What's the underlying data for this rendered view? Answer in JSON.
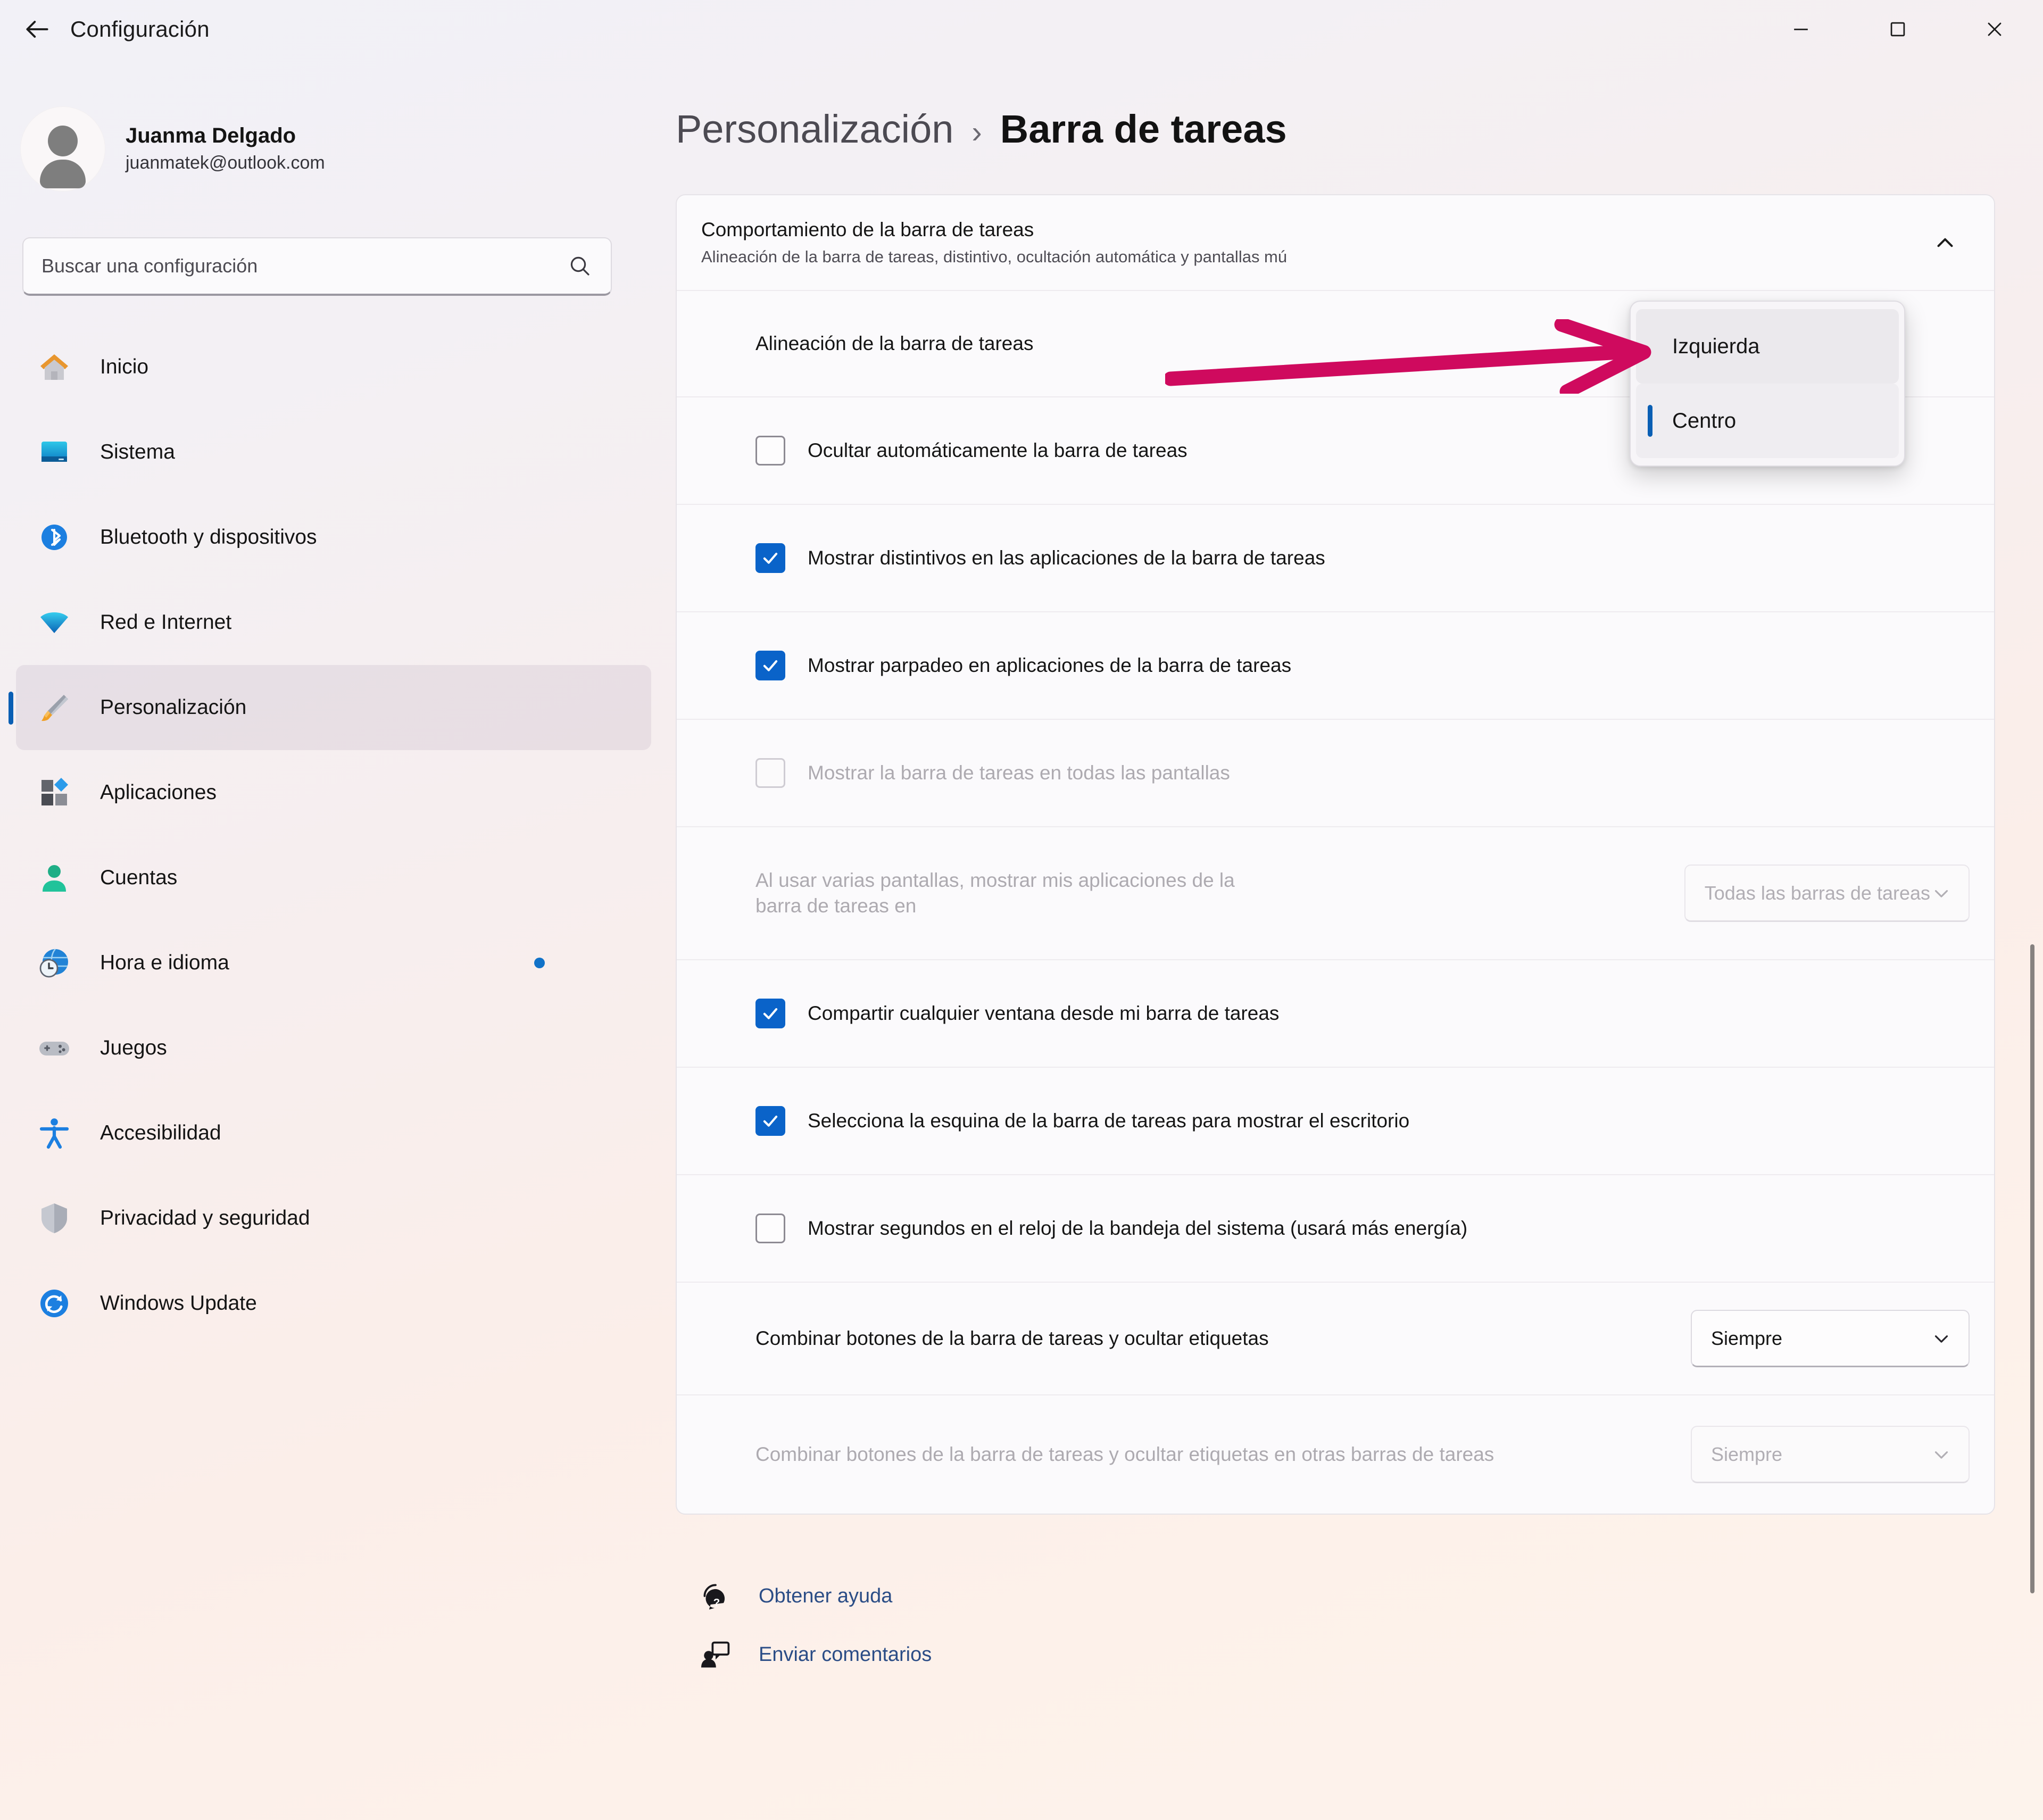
{
  "window": {
    "app_title": "Configuración",
    "back_label": "back-arrow",
    "controls": {
      "minimize": "—",
      "maximize": "▢",
      "close": "✕"
    }
  },
  "sidebar": {
    "account": {
      "name": "Juanma Delgado",
      "email": "juanmatek@outlook.com"
    },
    "search": {
      "placeholder": "Buscar una configuración"
    },
    "items": [
      {
        "label": "Inicio",
        "icon": "home-icon",
        "selected": false,
        "dot": false
      },
      {
        "label": "Sistema",
        "icon": "system-icon",
        "selected": false,
        "dot": false
      },
      {
        "label": "Bluetooth y dispositivos",
        "icon": "bluetooth-icon",
        "selected": false,
        "dot": false
      },
      {
        "label": "Red e Internet",
        "icon": "wifi-icon",
        "selected": false,
        "dot": false
      },
      {
        "label": "Personalización",
        "icon": "brush-icon",
        "selected": true,
        "dot": false
      },
      {
        "label": "Aplicaciones",
        "icon": "apps-icon",
        "selected": false,
        "dot": false
      },
      {
        "label": "Cuentas",
        "icon": "account-icon",
        "selected": false,
        "dot": false
      },
      {
        "label": "Hora e idioma",
        "icon": "clock-globe-icon",
        "selected": false,
        "dot": true
      },
      {
        "label": "Juegos",
        "icon": "gamepad-icon",
        "selected": false,
        "dot": false
      },
      {
        "label": "Accesibilidad",
        "icon": "accessibility-icon",
        "selected": false,
        "dot": false
      },
      {
        "label": "Privacidad y seguridad",
        "icon": "shield-icon",
        "selected": false,
        "dot": false
      },
      {
        "label": "Windows Update",
        "icon": "update-icon",
        "selected": false,
        "dot": false
      }
    ]
  },
  "main": {
    "breadcrumb": {
      "parent": "Personalización",
      "separator": "›",
      "current": "Barra de tareas"
    },
    "section": {
      "title": "Comportamiento de la barra de tareas",
      "subtitle": "Alineación de la barra de tareas, distintivo, ocultación automática y pantallas mú",
      "expanded": true,
      "chevron": "chevron-up-icon"
    },
    "rows": [
      {
        "kind": "combo",
        "label": "Alineación de la barra de tareas",
        "value": "",
        "disabled": false
      },
      {
        "kind": "checkbox",
        "label": "Ocultar automáticamente la barra de tareas",
        "checked": false,
        "disabled": false
      },
      {
        "kind": "checkbox",
        "label": "Mostrar distintivos en las aplicaciones de la barra de tareas",
        "checked": true,
        "disabled": false
      },
      {
        "kind": "checkbox",
        "label": "Mostrar parpadeo en aplicaciones de la barra de tareas",
        "checked": true,
        "disabled": false
      },
      {
        "kind": "checkbox",
        "label": "Mostrar la barra de tareas en todas las pantallas",
        "checked": false,
        "disabled": true
      },
      {
        "kind": "combo",
        "label": "Al usar varias pantallas, mostrar mis aplicaciones de la barra de tareas en",
        "value": "Todas las barras de tareas",
        "disabled": true
      },
      {
        "kind": "checkbox",
        "label": "Compartir cualquier ventana desde mi barra de tareas",
        "checked": true,
        "disabled": false
      },
      {
        "kind": "checkbox",
        "label": "Selecciona la esquina de la barra de tareas para mostrar el escritorio",
        "checked": true,
        "disabled": false
      },
      {
        "kind": "checkbox",
        "label": "Mostrar segundos en el reloj de la bandeja del sistema (usará más energía)",
        "checked": false,
        "disabled": false
      },
      {
        "kind": "combo",
        "label": "Combinar botones de la barra de tareas y ocultar etiquetas",
        "value": "Siempre",
        "disabled": false
      },
      {
        "kind": "combo",
        "label": "Combinar botones de la barra de tareas y ocultar etiquetas en otras barras de tareas",
        "value": "Siempre",
        "disabled": true
      }
    ],
    "footer_links": [
      {
        "label": "Obtener ayuda",
        "icon": "help-icon"
      },
      {
        "label": "Enviar comentarios",
        "icon": "feedback-icon"
      }
    ]
  },
  "flyout": {
    "options": [
      {
        "label": "Izquierda",
        "state": "hover"
      },
      {
        "label": "Centro",
        "state": "selected"
      }
    ]
  },
  "annotation": {
    "type": "arrow",
    "direction": "right",
    "color": "#cf0a5e"
  },
  "colors": {
    "accent": "#0a63c9",
    "selection_bar": "#0a5fb4",
    "link": "#2b4d86",
    "annotation": "#cf0a5e",
    "notification_dot": "#1172c8"
  }
}
